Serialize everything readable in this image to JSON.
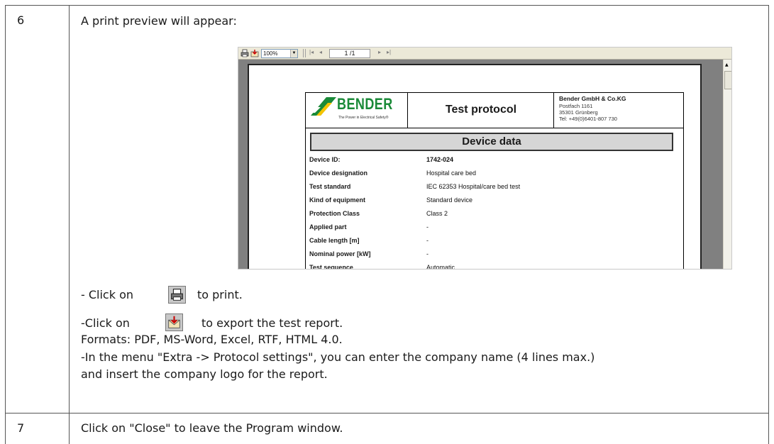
{
  "steps": [
    {
      "number": "6",
      "intro": "A print preview will appear:",
      "print_line": {
        "before": "- Click on",
        "after": "to print."
      },
      "export_line": {
        "before": "-Click on",
        "after": "to export the test report."
      },
      "formats": "Formats: PDF, MS-Word, Excel, RTF, HTML 4.0.",
      "menu_line_1": "-In the menu \"Extra -> Protocol settings\", you can enter the company name (4 lines max.)",
      "menu_line_2": "and insert the company logo for the report."
    },
    {
      "number": "7",
      "text": "Click on \"Close\" to leave the Program window."
    }
  ],
  "preview": {
    "toolbar": {
      "zoom": "100%",
      "page_indicator": "1 /1",
      "icons": [
        "printer-icon",
        "export-icon",
        "first-page-icon",
        "previous-page-icon",
        "next-page-icon",
        "last-page-icon"
      ]
    },
    "header": {
      "logo_text": "BENDER",
      "logo_tagline": "The Power in Electrical Safety®",
      "title": "Test protocol",
      "company": "Bender GmbH & Co.KG",
      "address_1": "Postfach 1161",
      "address_2": "35301 Grünberg",
      "phone": "Tel: +49(0)6401-807 730"
    },
    "device_data": {
      "title": "Device data",
      "rows": [
        {
          "label": "Device ID:",
          "value": "1742-024"
        },
        {
          "label": "Device designation",
          "value": "Hospital care bed"
        },
        {
          "label": "Test standard",
          "value": "IEC 62353 Hospital/care bed test"
        },
        {
          "label": "Kind of equipment",
          "value": "Standard device"
        },
        {
          "label": "Protection Class",
          "value": "Class 2"
        },
        {
          "label": "Applied part",
          "value": "-"
        },
        {
          "label": "Cable length  [m]",
          "value": "-"
        },
        {
          "label": "Nominal power  [kW]",
          "value": "-"
        },
        {
          "label": "Test sequence",
          "value": "Automatic"
        }
      ]
    }
  },
  "colors": {
    "logo_green": "#1a8a38",
    "logo_yellow": "#f5c400",
    "header_fill": "#d6d6d6",
    "grid": "#555555"
  }
}
